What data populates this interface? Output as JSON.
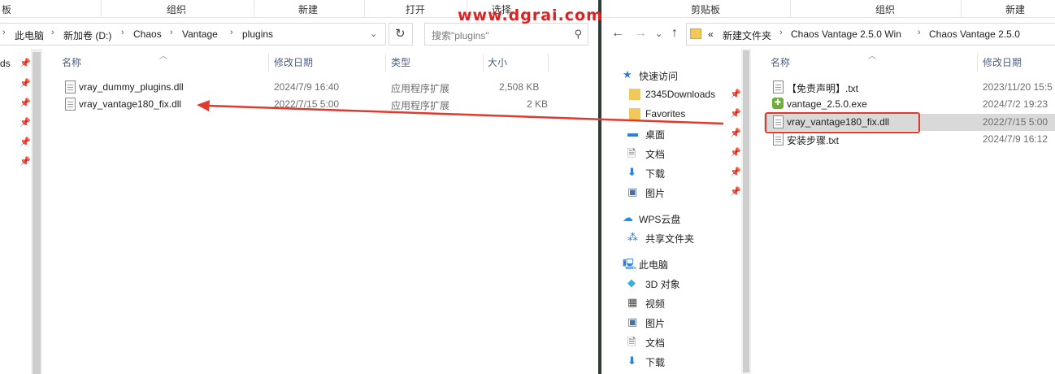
{
  "watermark": "www.dgrai.com",
  "left": {
    "ribbon": [
      "板",
      "组织",
      "新建",
      "打开",
      "选择"
    ],
    "breadcrumb": [
      "此电脑",
      "新加卷 (D:)",
      "Chaos",
      "Vantage",
      "plugins"
    ],
    "search_placeholder": "搜索\"plugins\"",
    "columns": {
      "name": "名称",
      "date": "修改日期",
      "type": "类型",
      "size": "大小"
    },
    "nav_partial": "ds",
    "files": [
      {
        "name": "vray_dummy_plugins.dll",
        "date": "2024/7/9 16:40",
        "type": "应用程序扩展",
        "size": "2,508 KB"
      },
      {
        "name": "vray_vantage180_fix.dll",
        "date": "2022/7/15 5:00",
        "type": "应用程序扩展",
        "size": "2 KB"
      }
    ]
  },
  "right": {
    "ribbon": [
      "剪贴板",
      "组织",
      "新建"
    ],
    "breadcrumb": [
      "«",
      "新建文件夹",
      "Chaos Vantage 2.5.0 Win",
      "Chaos Vantage 2.5.0"
    ],
    "columns": {
      "name": "名称",
      "date": "修改日期"
    },
    "nav": [
      {
        "label": "快速访问",
        "icon": "star-icon"
      },
      {
        "label": "2345Downloads",
        "icon": "folder-icon"
      },
      {
        "label": "Favorites",
        "icon": "folder-icon"
      },
      {
        "label": "桌面",
        "icon": "desktop-icon"
      },
      {
        "label": "文档",
        "icon": "document-icon"
      },
      {
        "label": "下载",
        "icon": "download-icon"
      },
      {
        "label": "图片",
        "icon": "picture-icon"
      },
      {
        "label": "WPS云盘",
        "icon": "cloud-icon"
      },
      {
        "label": "共享文件夹",
        "icon": "share-icon"
      },
      {
        "label": "此电脑",
        "icon": "computer-icon"
      },
      {
        "label": "3D 对象",
        "icon": "cube-icon"
      },
      {
        "label": "视频",
        "icon": "video-icon"
      },
      {
        "label": "图片",
        "icon": "picture-icon"
      },
      {
        "label": "文档",
        "icon": "document-icon"
      },
      {
        "label": "下载",
        "icon": "download-icon"
      }
    ],
    "files": [
      {
        "name": "【免责声明】.txt",
        "date": "2023/11/20 15:5"
      },
      {
        "name": "vantage_2.5.0.exe",
        "date": "2024/7/2 19:23"
      },
      {
        "name": "vray_vantage180_fix.dll",
        "date": "2022/7/15 5:00"
      },
      {
        "name": "安装步骤.txt",
        "date": "2024/7/9 16:12"
      }
    ]
  },
  "colors": {
    "annotation": "#e03a2f",
    "selection": "#d9d9d9",
    "column_header": "#4d6082"
  }
}
